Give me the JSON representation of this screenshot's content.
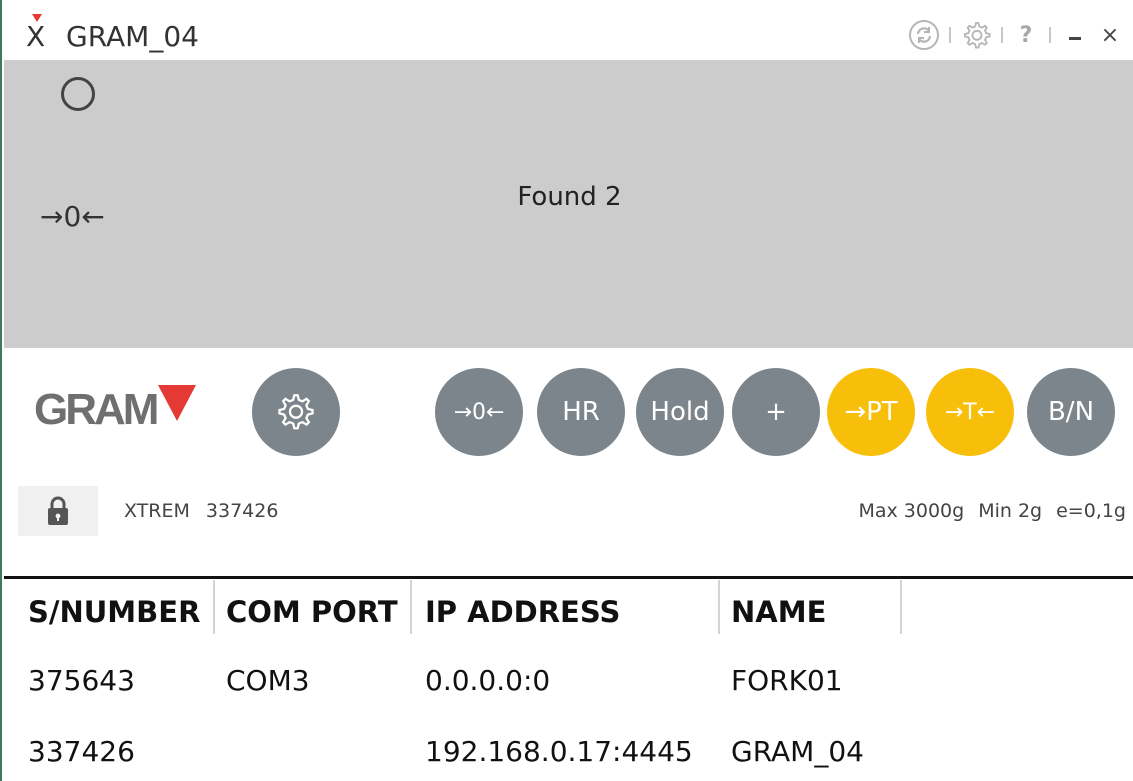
{
  "window": {
    "title": "GRAM_04",
    "app_logo_icon": "xtrem-logo-icon"
  },
  "title_controls": [
    {
      "name": "refresh-icon"
    },
    {
      "name": "gear-icon"
    },
    {
      "name": "help-icon",
      "label": "?"
    },
    {
      "name": "minimize-icon"
    },
    {
      "name": "close-icon",
      "label": "×"
    }
  ],
  "display": {
    "status": "Found 2",
    "zero_indicator": "→0←",
    "stable_indicator_icon": "circle-icon",
    "background": "#cccccc"
  },
  "brand": {
    "text": "GRAM",
    "accent": "#e53935"
  },
  "buttons": {
    "settings_icon": "gear-icon",
    "zero": "→0←",
    "hr": "HR",
    "hold": "Hold",
    "plus": "+",
    "pt": "→PT",
    "tare": "→T←",
    "bn": "B/N",
    "gray_color": "#7b858b",
    "yellow_color": "#f8bf0a"
  },
  "info": {
    "lock_icon": "lock-icon",
    "model": "XTREM",
    "serial": "337426",
    "max": "Max 3000g",
    "min": "Min 2g",
    "e": "e=0,1g"
  },
  "table": {
    "headers": [
      "S/NUMBER",
      "COM PORT",
      "IP ADDRESS",
      "NAME"
    ],
    "rows": [
      {
        "serial": "375643",
        "com": "COM3",
        "ip": "0.0.0.0:0",
        "name": "FORK01"
      },
      {
        "serial": "337426",
        "com": "",
        "ip": "192.168.0.17:4445",
        "name": "GRAM_04"
      }
    ]
  }
}
